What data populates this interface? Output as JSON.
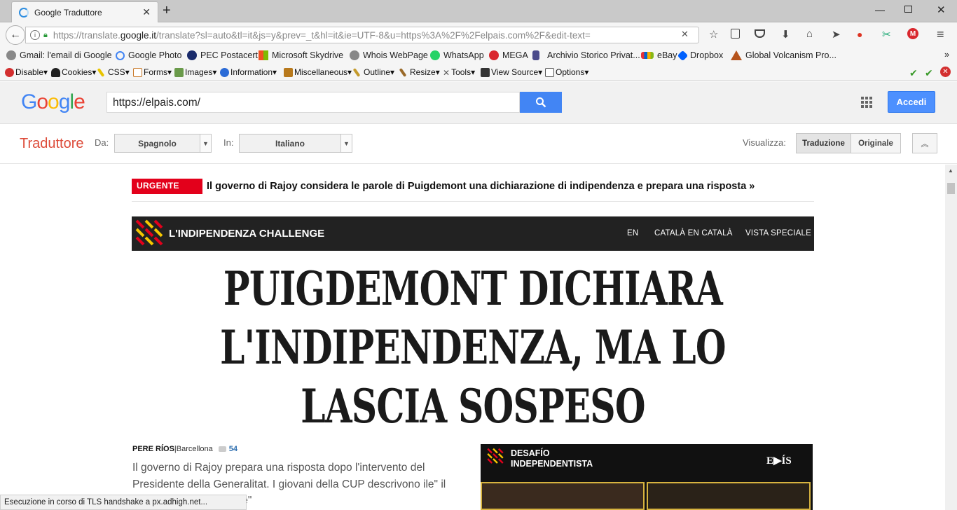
{
  "browser": {
    "tab_title": "Google Traduttore",
    "url_prefix": "https://translate.",
    "url_domain": "google.it",
    "url_rest": "/translate?sl=auto&tl=it&js=y&prev=_t&hl=it&ie=UTF-8&u=https%3A%2F%2Felpais.com%2F&edit-text="
  },
  "bookmarks": [
    {
      "label": "Gmail: l'email di Google",
      "icon": "globe-icon",
      "color": "#7a7a7a"
    },
    {
      "label": "Google Photo",
      "icon": "google-g-icon",
      "color": "#4285f4"
    },
    {
      "label": "PEC Postacert",
      "icon": "postacert-icon",
      "color": "#1a2b6b"
    },
    {
      "label": "Microsoft Skydrive",
      "icon": "windows-icon",
      "color": "#f25022"
    },
    {
      "label": "Whois WebPage",
      "icon": "globe-icon",
      "color": "#7a7a7a"
    },
    {
      "label": "WhatsApp",
      "icon": "whatsapp-icon",
      "color": "#25d366"
    },
    {
      "label": "MEGA",
      "icon": "mega-icon",
      "color": "#d9272e"
    },
    {
      "label": "Archivio Storico Privat...",
      "icon": "figure-icon",
      "color": "#4a4a8a"
    },
    {
      "label": "eBay",
      "icon": "ebay-icon",
      "color": "#e53238"
    },
    {
      "label": "Dropbox",
      "icon": "dropbox-icon",
      "color": "#0061fe"
    },
    {
      "label": "Global Volcanism Pro...",
      "icon": "volcano-icon",
      "color": "#b5531c"
    }
  ],
  "devbar": [
    {
      "label": "Disable",
      "icon": "disable-icon",
      "color": "#d32f2f"
    },
    {
      "label": "Cookies",
      "icon": "cookies-icon",
      "color": "#222"
    },
    {
      "label": "CSS",
      "icon": "css-icon",
      "color": "#c8a600"
    },
    {
      "label": "Forms",
      "icon": "forms-icon",
      "color": "#c97a2a"
    },
    {
      "label": "Images",
      "icon": "images-icon",
      "color": "#4a7a3a"
    },
    {
      "label": "Information",
      "icon": "information-icon",
      "color": "#2b6bd6"
    },
    {
      "label": "Miscellaneous",
      "icon": "misc-icon",
      "color": "#b8791c"
    },
    {
      "label": "Outline",
      "icon": "outline-icon",
      "color": "#c49a2c"
    },
    {
      "label": "Resize",
      "icon": "resize-icon",
      "color": "#9a6a2a"
    },
    {
      "label": "Tools",
      "icon": "tools-icon",
      "color": "#666"
    },
    {
      "label": "View Source",
      "icon": "view-source-icon",
      "color": "#333"
    },
    {
      "label": "Options",
      "icon": "options-icon",
      "color": "#555"
    }
  ],
  "google": {
    "search_value": "https://elpais.com/",
    "accedi": "Accedi"
  },
  "translate": {
    "brand": "Traduttore",
    "from_label": "Da:",
    "from_value": "Spagnolo",
    "to_label": "In:",
    "to_value": "Italiano",
    "view_label": "Visualizza:",
    "view_translation": "Traduzione",
    "view_original": "Originale"
  },
  "article": {
    "urgent_badge": "URGENTE",
    "urgent_text": "Il governo di Rajoy considera le parole di Puigdemont una dichiarazione di indipendenza e prepara una risposta »",
    "section_title": "L'INDIPENDENZA CHALLENGE",
    "section_links": [
      "EN",
      "CATALÀ EN CATALÀ",
      "VISTA SPECIALE"
    ],
    "headline_lines": [
      "PUIGDEMONT DICHIARA",
      "L'INDIPENDENZA, MA LO",
      "LASCIA SOSPESO"
    ],
    "author": "PERE RÍOS",
    "location": "|Barcellona",
    "comment_count": "54",
    "summary": "Il governo di Rajoy prepara una risposta dopo l'intervento del Presidente della Generalitat. I giovani della CUP descrivono                 ile\" il discorso del \"presidente\"",
    "video_title_1": "DESAFÍO",
    "video_title_2": "INDEPENDENTISTA",
    "video_logo": "E▶ÍS"
  },
  "status_text": "Esecuzione in corso di TLS handshake a px.adhigh.net..."
}
